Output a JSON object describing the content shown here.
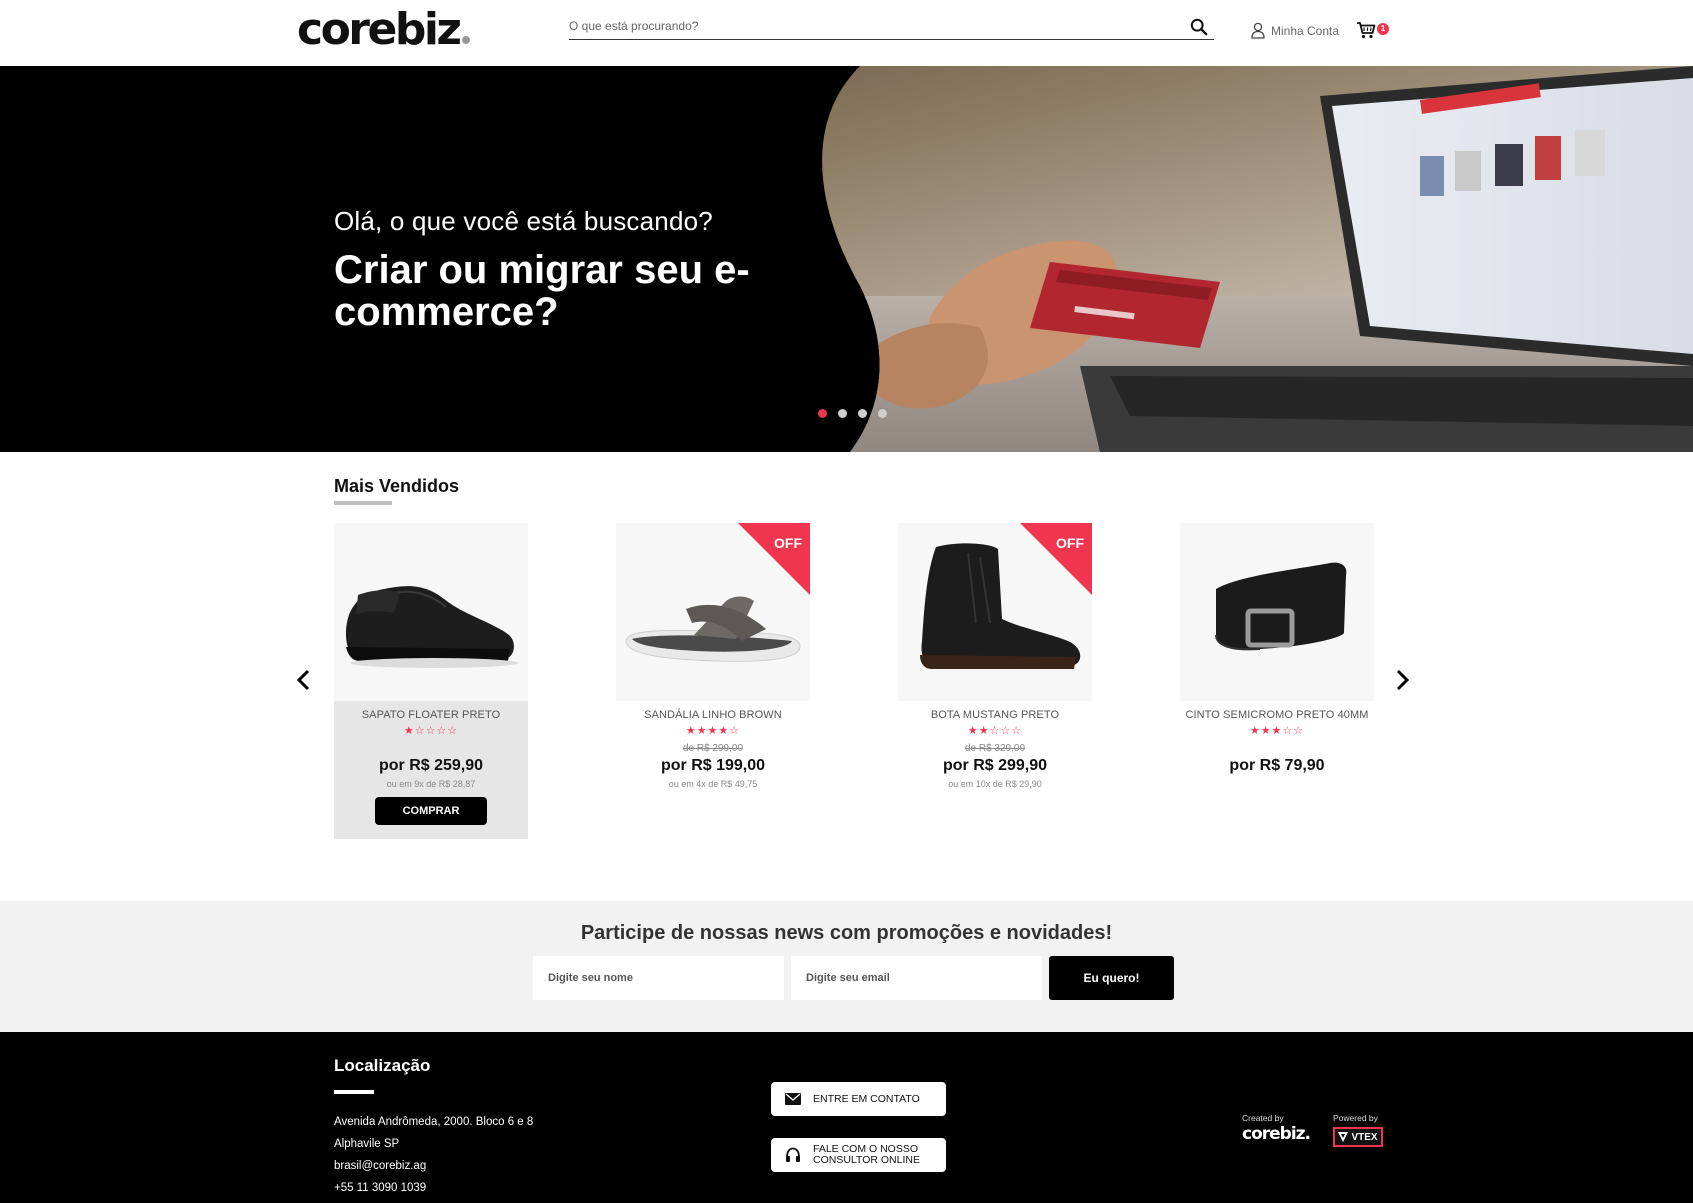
{
  "header": {
    "logo": "corebiz",
    "search_placeholder": "O que está procurando?",
    "account_label": "Minha Conta",
    "cart_count": "1"
  },
  "hero": {
    "subtitle": "Olá, o que você está buscando?",
    "title": "Criar ou migrar seu e-commerce?",
    "slides": 4,
    "active_slide": 1
  },
  "best_sellers": {
    "title": "Mais Vendidos",
    "products": [
      {
        "name": "SAPATO FLOATER PRETO",
        "rating": 1,
        "list_price": "",
        "price": "por R$ 259,90",
        "installments": "ou em 9x de R$ 28,87",
        "off": false,
        "buy_label": "COMPRAR",
        "image": "black-oxford-shoe"
      },
      {
        "name": "SANDÁLIA LINHO BROWN",
        "rating": 4,
        "list_price": "de R$ 299,00",
        "price": "por R$ 199,00",
        "installments": "ou em 4x de R$ 49,75",
        "off": true,
        "image": "brown-slide-sandal"
      },
      {
        "name": "BOTA MUSTANG PRETO",
        "rating": 2,
        "list_price": "de R$ 329,00",
        "price": "por R$ 299,90",
        "installments": "ou em 10x de R$ 29,90",
        "off": true,
        "image": "black-leather-boot"
      },
      {
        "name": "CINTO SEMICROMO PRETO 40MM",
        "rating": 3,
        "list_price": "",
        "price": "por R$ 79,90",
        "installments": "",
        "off": false,
        "image": "black-leather-belt"
      }
    ],
    "off_label": "OFF"
  },
  "newsletter": {
    "title": "Participe de nossas news com promoções e novidades!",
    "name_placeholder": "Digite seu nome",
    "email_placeholder": "Digite seu email",
    "button": "Eu quero!"
  },
  "footer": {
    "location_title": "Localização",
    "address_lines": [
      "Avenida Andrômeda, 2000. Bloco 6 e 8",
      "Alphavile SP",
      "brasil@corebiz.ag",
      "+55 11 3090 1039"
    ],
    "contact_button": "ENTRE EM CONTATO",
    "consultant_button_line1": "FALE COM O NOSSO",
    "consultant_button_line2": "CONSULTOR ONLINE",
    "created_by": "Created by",
    "created_logo": "corebiz.",
    "powered_by": "Powered by",
    "powered_logo": "VTEX"
  },
  "colors": {
    "accent": "#f0354f",
    "black": "#000000",
    "newsletter_bg": "#f2f2f2"
  }
}
